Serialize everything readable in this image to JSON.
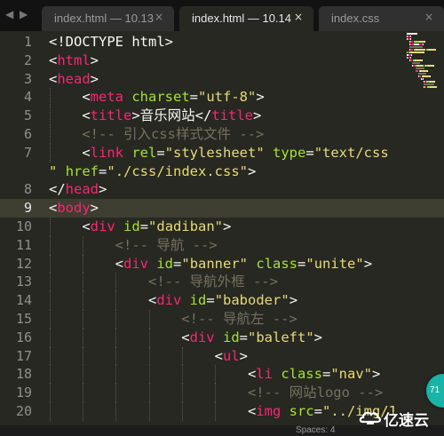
{
  "colors": {
    "background": "#272822",
    "tag": "#f92672",
    "attribute": "#a6e22e",
    "string": "#e6db74",
    "comment": "#75715e",
    "text": "#f8f8f2",
    "current_line": "#3e3d32",
    "badge": "#18b4a8"
  },
  "tabs": [
    {
      "label": "index.html — 10.13",
      "close": "×",
      "state": "inactive"
    },
    {
      "label": "index.html — 10.14",
      "close": "×",
      "state": "active"
    },
    {
      "label": "index.css",
      "close": "×",
      "state": "inactive"
    }
  ],
  "nav": {
    "left": "◀",
    "right": "▶"
  },
  "editor": {
    "current_line": 9,
    "lines": [
      {
        "num": "1",
        "tokens": [
          [
            "tx",
            "<!DOCTYPE html>"
          ]
        ]
      },
      {
        "num": "2",
        "tokens": [
          [
            "tx",
            "<"
          ],
          [
            "tg",
            "html"
          ],
          [
            "tx",
            ">"
          ]
        ]
      },
      {
        "num": "3",
        "tokens": [
          [
            "tx",
            "<"
          ],
          [
            "tg",
            "head"
          ],
          [
            "tx",
            ">"
          ]
        ]
      },
      {
        "num": "4",
        "tokens": [
          [
            "tx",
            "    <"
          ],
          [
            "tg",
            "meta"
          ],
          [
            "tx",
            " "
          ],
          [
            "at",
            "charset"
          ],
          [
            "tx",
            "="
          ],
          [
            "st",
            "\"utf-8\""
          ],
          [
            "tx",
            ">"
          ]
        ]
      },
      {
        "num": "5",
        "tokens": [
          [
            "tx",
            "    <"
          ],
          [
            "tg",
            "title"
          ],
          [
            "tx",
            ">音乐网站</"
          ],
          [
            "tg",
            "title"
          ],
          [
            "tx",
            ">"
          ]
        ]
      },
      {
        "num": "6",
        "tokens": [
          [
            "tx",
            "    "
          ],
          [
            "cm",
            "<!-- 引入css样式文件 -->"
          ]
        ]
      },
      {
        "num": "7",
        "tokens": [
          [
            "tx",
            "    <"
          ],
          [
            "tg",
            "link"
          ],
          [
            "tx",
            " "
          ],
          [
            "at",
            "rel"
          ],
          [
            "tx",
            "="
          ],
          [
            "st",
            "\"stylesheet\""
          ],
          [
            "tx",
            " "
          ],
          [
            "at",
            "type"
          ],
          [
            "tx",
            "="
          ],
          [
            "st",
            "\"text/css"
          ]
        ]
      },
      {
        "num": "",
        "tokens": [
          [
            "st",
            "\""
          ],
          [
            "tx",
            " "
          ],
          [
            "at",
            "href"
          ],
          [
            "tx",
            "="
          ],
          [
            "st",
            "\"./css/index.css\""
          ],
          [
            "tx",
            ">"
          ]
        ]
      },
      {
        "num": "8",
        "tokens": [
          [
            "tx",
            "</"
          ],
          [
            "tg",
            "head"
          ],
          [
            "tx",
            ">"
          ]
        ]
      },
      {
        "num": "9",
        "tokens": [
          [
            "tx",
            "<"
          ],
          [
            "tg",
            "body"
          ],
          [
            "tx",
            ">"
          ]
        ]
      },
      {
        "num": "10",
        "tokens": [
          [
            "tx",
            "    <"
          ],
          [
            "tg",
            "div"
          ],
          [
            "tx",
            " "
          ],
          [
            "at",
            "id"
          ],
          [
            "tx",
            "="
          ],
          [
            "st",
            "\"dadiban\""
          ],
          [
            "tx",
            ">"
          ]
        ]
      },
      {
        "num": "11",
        "tokens": [
          [
            "tx",
            "        "
          ],
          [
            "cm",
            "<!-- 导航 -->"
          ]
        ]
      },
      {
        "num": "12",
        "tokens": [
          [
            "tx",
            "        <"
          ],
          [
            "tg",
            "div"
          ],
          [
            "tx",
            " "
          ],
          [
            "at",
            "id"
          ],
          [
            "tx",
            "="
          ],
          [
            "st",
            "\"banner\""
          ],
          [
            "tx",
            " "
          ],
          [
            "at",
            "class"
          ],
          [
            "tx",
            "="
          ],
          [
            "st",
            "\"unite\""
          ],
          [
            "tx",
            ">"
          ]
        ]
      },
      {
        "num": "13",
        "tokens": [
          [
            "tx",
            "            "
          ],
          [
            "cm",
            "<!-- 导航外框 -->"
          ]
        ]
      },
      {
        "num": "14",
        "tokens": [
          [
            "tx",
            "            <"
          ],
          [
            "tg",
            "div"
          ],
          [
            "tx",
            " "
          ],
          [
            "at",
            "id"
          ],
          [
            "tx",
            "="
          ],
          [
            "st",
            "\"baboder\""
          ],
          [
            "tx",
            ">"
          ]
        ]
      },
      {
        "num": "15",
        "tokens": [
          [
            "tx",
            "                "
          ],
          [
            "cm",
            "<!-- 导航左 -->"
          ]
        ]
      },
      {
        "num": "16",
        "tokens": [
          [
            "tx",
            "                <"
          ],
          [
            "tg",
            "div"
          ],
          [
            "tx",
            " "
          ],
          [
            "at",
            "id"
          ],
          [
            "tx",
            "="
          ],
          [
            "st",
            "\"baleft\""
          ],
          [
            "tx",
            ">"
          ]
        ]
      },
      {
        "num": "17",
        "tokens": [
          [
            "tx",
            "                    <"
          ],
          [
            "tg",
            "ul"
          ],
          [
            "tx",
            ">"
          ]
        ]
      },
      {
        "num": "18",
        "tokens": [
          [
            "tx",
            "                        <"
          ],
          [
            "tg",
            "li"
          ],
          [
            "tx",
            " "
          ],
          [
            "at",
            "class"
          ],
          [
            "tx",
            "="
          ],
          [
            "st",
            "\"nav\""
          ],
          [
            "tx",
            ">"
          ]
        ]
      },
      {
        "num": "19",
        "tokens": [
          [
            "tx",
            "                        "
          ],
          [
            "cm",
            "<!-- 网站logo -->"
          ]
        ]
      },
      {
        "num": "20",
        "tokens": [
          [
            "tx",
            "                        <"
          ],
          [
            "tg",
            "img"
          ],
          [
            "tx",
            " "
          ],
          [
            "at",
            "src"
          ],
          [
            "tx",
            "="
          ],
          [
            "st",
            "\"../img/1"
          ]
        ]
      }
    ]
  },
  "status": {
    "spaces": "Spaces: 4"
  },
  "badge": {
    "text": "71"
  },
  "watermark": {
    "text": "亿速云"
  }
}
